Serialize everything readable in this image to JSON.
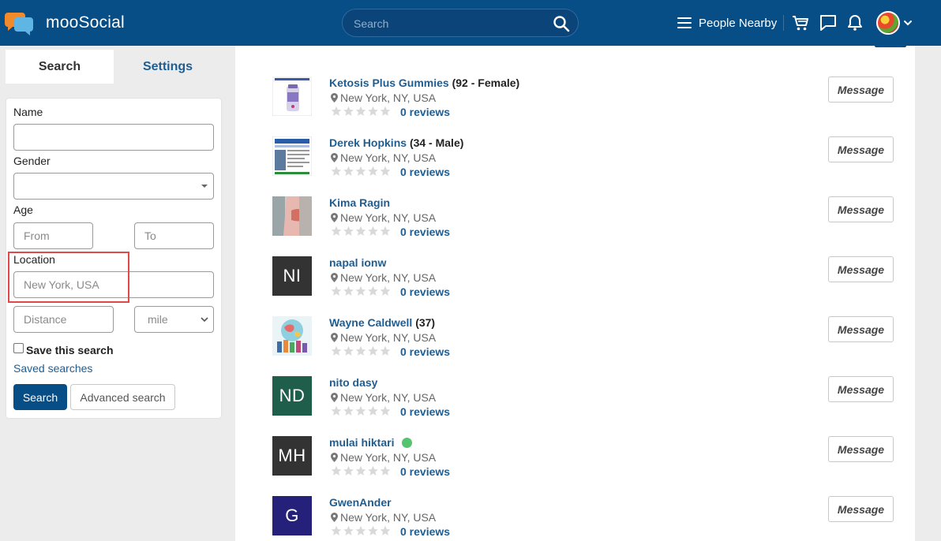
{
  "header": {
    "brand": "mooSocial",
    "search_placeholder": "Search",
    "nearby_label": "People Nearby"
  },
  "sidebar": {
    "tabs": [
      "Search",
      "Settings"
    ],
    "name_label": "Name",
    "gender_label": "Gender",
    "age_label": "Age",
    "age_from_placeholder": "From",
    "age_to_placeholder": "To",
    "location_label": "Location",
    "location_placeholder": "New York, USA",
    "distance_placeholder": "Distance",
    "unit_selected": "mile",
    "save_search_label": "Save this search",
    "saved_searches_link": "Saved searches",
    "search_button": "Search",
    "advanced_button": "Advanced search"
  },
  "users": [
    {
      "name": "Ketosis Plus Gummies",
      "meta": "(92 - Female)",
      "location": "New York, NY, USA",
      "reviews": "0 reviews",
      "avatar": "product-image",
      "online": false
    },
    {
      "name": "Derek Hopkins",
      "meta": "(34 - Male)",
      "location": "New York, NY, USA",
      "reviews": "0 reviews",
      "avatar": "document-image",
      "online": false
    },
    {
      "name": "Kima Ragin",
      "meta": "",
      "location": "New York, NY, USA",
      "reviews": "0 reviews",
      "avatar": "fitness-photo",
      "online": false
    },
    {
      "name": "napal ionw",
      "meta": "",
      "location": "New York, NY, USA",
      "reviews": "0 reviews",
      "initials": "NI",
      "avatar_color": "#333333",
      "online": false
    },
    {
      "name": "Wayne Caldwell",
      "meta": "(37)",
      "location": "New York, NY, USA",
      "reviews": "0 reviews",
      "avatar": "globe-illustration",
      "online": false
    },
    {
      "name": "nito dasy",
      "meta": "",
      "location": "New York, NY, USA",
      "reviews": "0 reviews",
      "initials": "ND",
      "avatar_color": "#1e5e4a",
      "online": false
    },
    {
      "name": "mulai hiktari",
      "meta": "",
      "location": "New York, NY, USA",
      "reviews": "0 reviews",
      "initials": "MH",
      "avatar_color": "#333333",
      "online": true
    },
    {
      "name": "GwenAnder",
      "meta": "",
      "location": "New York, NY, USA",
      "reviews": "0 reviews",
      "initials": "G",
      "avatar_color": "#25207a",
      "online": false
    }
  ],
  "message_button_label": "Message",
  "colors": {
    "header_bg": "#074d86",
    "link": "#1e5d92",
    "highlight": "#e0484a",
    "online": "#55c46f"
  }
}
